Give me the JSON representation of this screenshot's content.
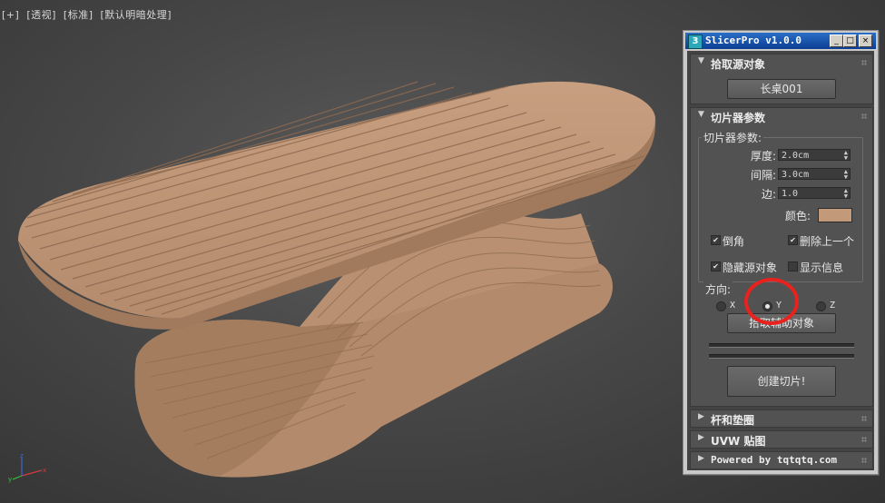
{
  "viewport": {
    "labels": [
      "[+]",
      "[透视]",
      "[标准]",
      "[默认明暗处理]"
    ],
    "object_color": "#c39a79",
    "axis": {
      "x": "x",
      "y": "y",
      "z": "z"
    }
  },
  "panel": {
    "title": "SlicerPro v1.0.0",
    "app_icon": "3",
    "controls": {
      "minimize": "_",
      "maximize": "□",
      "close": "×"
    },
    "pick_source": {
      "header": "拾取源对象",
      "button": "长桌001"
    },
    "slicer_params": {
      "header": "切片器参数",
      "group_title": "切片器参数:",
      "thickness": {
        "label": "厚度:",
        "value": "2.0cm"
      },
      "spacing": {
        "label": "间隔:",
        "value": "3.0cm"
      },
      "edge": {
        "label": "边:",
        "value": "1.0"
      },
      "color": {
        "label": "颜色:",
        "value": "#c39a79"
      },
      "chamfer": {
        "label": "倒角",
        "checked": true
      },
      "delete_prev": {
        "label": "删除上一个",
        "checked": true
      },
      "hide_source": {
        "label": "隐藏源对象",
        "checked": true
      },
      "show_info": {
        "label": "显示信息",
        "checked": false
      },
      "direction": {
        "title": "方向:",
        "options": [
          "X",
          "Y",
          "Z"
        ],
        "selected": "Y"
      },
      "pick_aux_button": "拾取辅助对象",
      "create_button": "创建切片!"
    },
    "rods": {
      "header": "杆和垫圈"
    },
    "uvw": {
      "header": "UVW 贴图"
    },
    "footer": {
      "header": "Powered by tqtqtq.com"
    }
  }
}
